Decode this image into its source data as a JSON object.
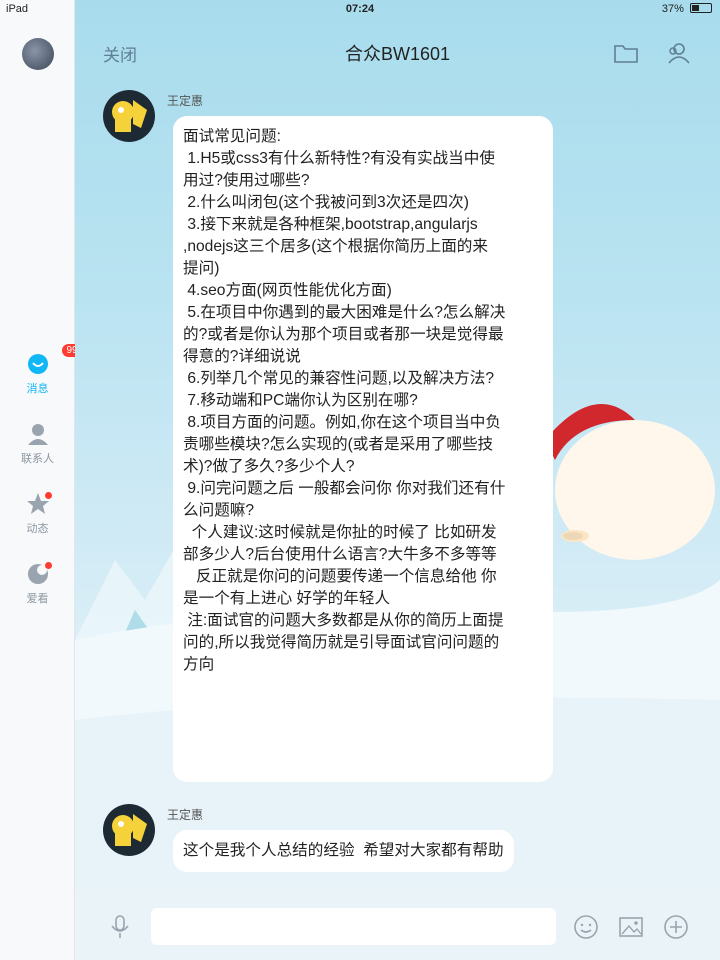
{
  "status_bar": {
    "device": "iPad",
    "time": "07:24",
    "battery": "37%"
  },
  "sidebar": {
    "items": [
      {
        "label": "消息",
        "badge": "99+",
        "icon": "chat-bubble-icon",
        "active": true
      },
      {
        "label": "联系人",
        "icon": "contact-person-icon"
      },
      {
        "label": "动态",
        "icon": "star-icon",
        "dot": true
      },
      {
        "label": "爱看",
        "icon": "watch-icon",
        "dot": true
      }
    ]
  },
  "header": {
    "close_label": "关闭",
    "title": "合众BW1601",
    "icons": [
      "folder-icon",
      "group-members-icon"
    ]
  },
  "messages": [
    {
      "sender": "王定惠",
      "lines": [
        "面试常见问题:",
        "",
        " 1.H5或css3有什么新特性?有没有实战当中使",
        "用过?使用过哪些?",
        " 2.什么叫闭包(这个我被问到3次还是四次)",
        " 3.接下来就是各种框架,bootstrap,angularjs",
        ",nodejs这三个居多(这个根据你简历上面的来",
        "提问)",
        " 4.seo方面(网页性能优化方面)",
        " 5.在项目中你遇到的最大困难是什么?怎么解决",
        "的?或者是你认为那个项目或者那一块是觉得最",
        "得意的?详细说说",
        " 6.列举几个常见的兼容性问题,以及解决方法?",
        " 7.移动端和PC端你认为区别在哪?",
        " 8.项目方面的问题。例如,你在这个项目当中负",
        "责哪些模块?怎么实现的(或者是采用了哪些技",
        "术)?做了多久?多少个人?",
        " 9.问完问题之后 一般都会问你 你对我们还有什",
        "么问题嘛?",
        "  个人建议:这时候就是你扯的时候了 比如研发",
        "部多少人?后台使用什么语言?大牛多不多等等",
        "   反正就是你问的问题要传递一个信息给他 你",
        "是一个有上进心 好学的年轻人",
        "",
        "",
        "",
        " 注:面试官的问题大多数都是从你的简历上面提",
        "问的,所以我觉得简历就是引导面试官问问题的",
        "方向"
      ]
    },
    {
      "sender": "王定惠",
      "lines": [
        "这个是我个人总结的经验  希望对大家都有帮助"
      ]
    }
  ],
  "input_bar": {
    "icons": [
      "microphone-icon",
      "emoji-icon",
      "image-icon",
      "plus-icon"
    ],
    "value": ""
  },
  "colors": {
    "accent": "#12b7f5",
    "badge": "#ff3b30"
  }
}
